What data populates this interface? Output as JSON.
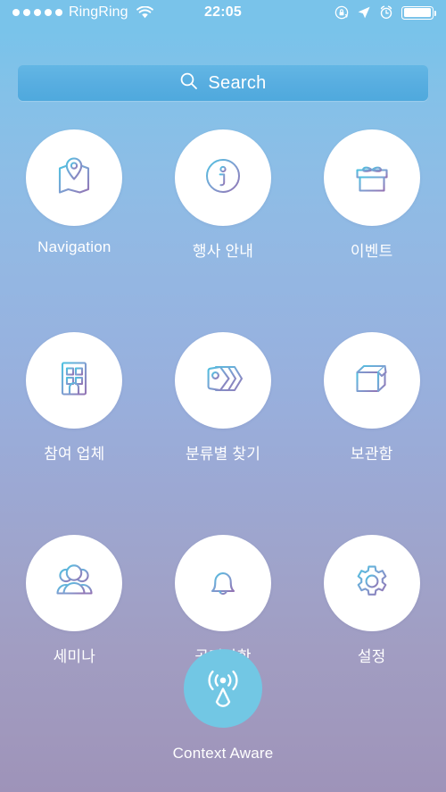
{
  "status_bar": {
    "signal_dots": 5,
    "carrier": "RingRing",
    "wifi_icon": "wifi-icon",
    "time": "22:05",
    "right_icons": [
      {
        "name": "rotation-lock-icon"
      },
      {
        "name": "location-arrow-icon"
      },
      {
        "name": "alarm-clock-icon"
      },
      {
        "name": "battery-icon"
      }
    ],
    "battery_level_percent": 100
  },
  "search": {
    "icon": "search-icon",
    "placeholder": "Search",
    "value": ""
  },
  "grid": {
    "rows": [
      {
        "cells": [
          {
            "label": "Navigation",
            "icon": "map-pin-icon"
          },
          {
            "label": "행사 안내",
            "icon": "info-circle-icon"
          },
          {
            "label": "이벤트",
            "icon": "gift-icon"
          }
        ]
      },
      {
        "cells": [
          {
            "label": "참여 업체",
            "icon": "building-icon"
          },
          {
            "label": "분류별 찾기",
            "icon": "tags-icon"
          },
          {
            "label": "보관함",
            "icon": "storage-box-icon"
          }
        ]
      },
      {
        "cells": [
          {
            "label": "세미나",
            "icon": "people-group-icon"
          },
          {
            "label": "공지사항",
            "icon": "bell-icon"
          },
          {
            "label": "설정",
            "icon": "gear-icon"
          }
        ]
      }
    ]
  },
  "context_aware": {
    "label": "Context Aware",
    "icon": "beacon-signal-icon"
  },
  "colors": {
    "background_top": "#79c3ea",
    "background_bottom": "#9e93b9",
    "search_bar": "#57ade0",
    "tile_background": "#ffffff",
    "icon_gradient_start": "#5bc0de",
    "icon_gradient_end": "#8f7bb5",
    "context_circle": "#72c7e4",
    "label_text": "#ffffff"
  }
}
